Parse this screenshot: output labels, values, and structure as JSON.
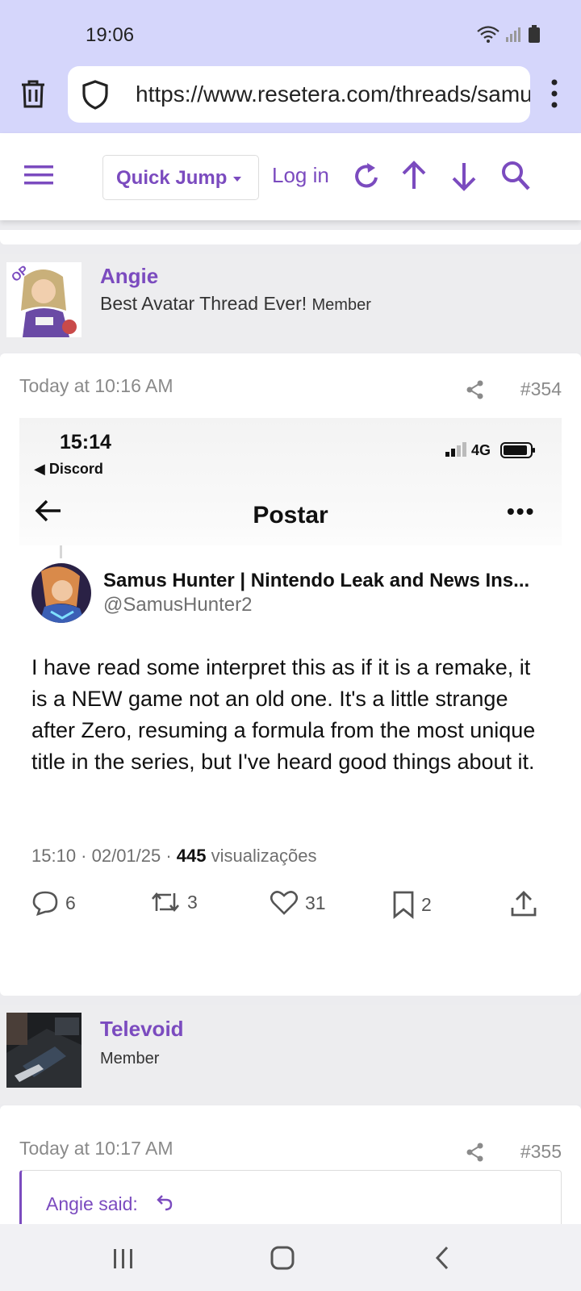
{
  "status_bar": {
    "time": "19:06"
  },
  "browser": {
    "url": "https://www.resetera.com/threads/samus"
  },
  "nav": {
    "quick_jump": "Quick Jump",
    "login": "Log in"
  },
  "posts": [
    {
      "username": "Angie",
      "op_badge": "OP",
      "title": "Best Avatar Thread Ever!",
      "role": "Member",
      "date": "Today at 10:16 AM",
      "number": "#354"
    },
    {
      "username": "Televoid",
      "role": "Member",
      "date": "Today at 10:17 AM",
      "number": "#355",
      "quote_label": "Angie said:"
    }
  ],
  "embed": {
    "time": "15:14",
    "back": "◀ Discord",
    "network": "4G",
    "title": "Postar",
    "tweet": {
      "name": "Samus Hunter | Nintendo Leak and News Ins...",
      "handle": "@SamusHunter2",
      "text": "I have read some interpret this as if it is a remake, it is a NEW game not an old one. It's a little strange after Zero, resuming a formula from the most unique title in the series, but I've heard good things about it.",
      "meta_prefix": "15:10 · 02/01/25 · ",
      "views": "445",
      "views_label": " visualizações",
      "replies": "6",
      "retweets": "3",
      "likes": "31",
      "bookmarks": "2"
    }
  }
}
